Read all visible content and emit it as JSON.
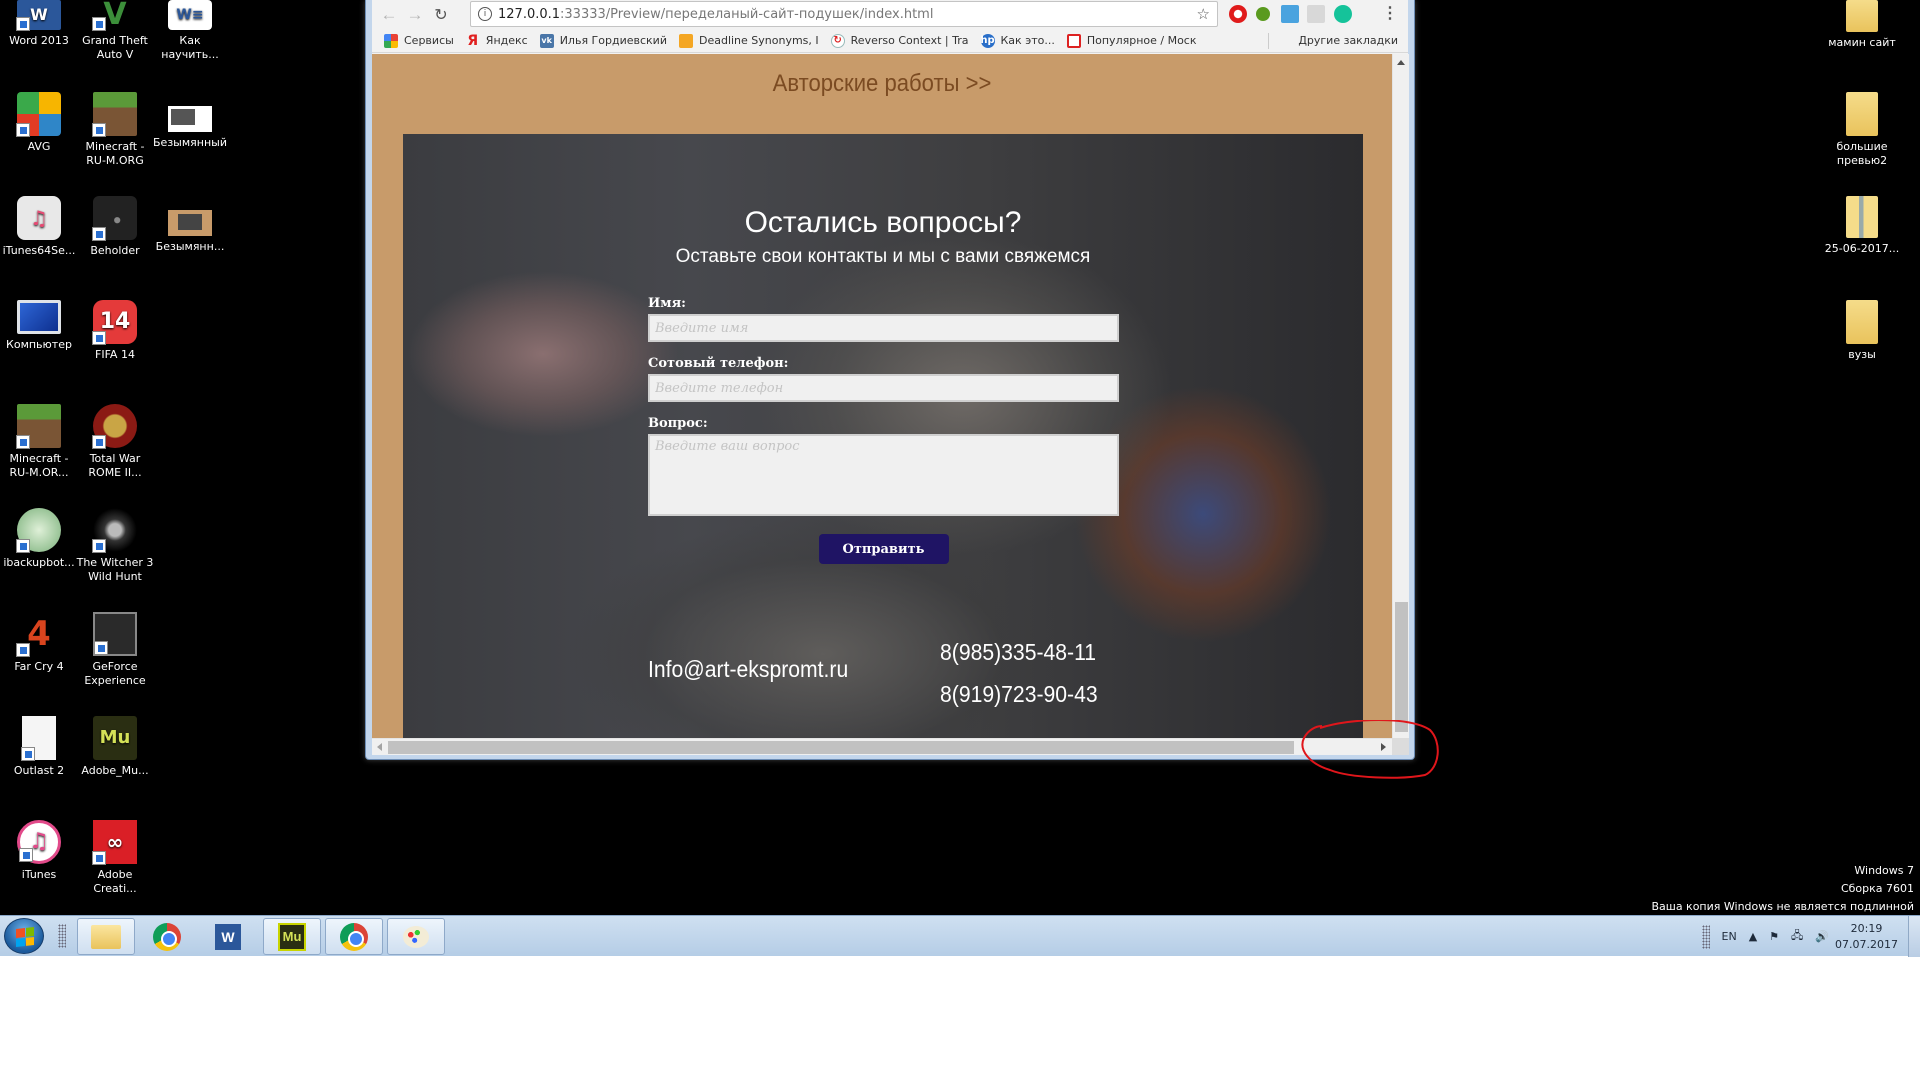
{
  "browser": {
    "url_host": "127.0.0.1",
    "url_port_path": ":33333/Preview/переделаный-сайт-подушек/index.html",
    "bookmarks": [
      {
        "label": "Сервисы",
        "icon": "apps-grid-icon"
      },
      {
        "label": "Яндекс",
        "icon": "yandex-icon"
      },
      {
        "label": "Илья Гордиевский",
        "icon": "vk-icon"
      },
      {
        "label": "Deadline Synonyms, I",
        "icon": "thesaurus-icon"
      },
      {
        "label": "Reverso Context | Tra",
        "icon": "reverso-icon"
      },
      {
        "label": "Как это...",
        "icon": "hp-icon"
      },
      {
        "label": "Популярное / Моск",
        "icon": "speech-bubble-icon"
      }
    ],
    "other_bookmarks": "Другие закладки",
    "extensions": [
      "opera-vpn",
      "bug-extension",
      "upload-extension",
      "dropbox",
      "grammarly"
    ]
  },
  "page": {
    "works_link": "Авторские работы >>",
    "hero_title": "Остались вопросы?",
    "hero_subtitle": "Оставьте свои контакты и мы с вами свяжемся",
    "form": {
      "name_label": "Имя:",
      "name_placeholder": "Введите имя",
      "phone_label": "Сотовый телефон:",
      "phone_placeholder": "Введите телефон",
      "question_label": "Вопрос:",
      "question_placeholder": "Введите ваш вопрос",
      "submit_label": "Отправить"
    },
    "contacts": {
      "email": "Info@art-ekspromt.ru",
      "phones": [
        "8(985)335-48-11",
        "8(919)723-90-43"
      ]
    },
    "colors": {
      "page_bg": "#c89b6a",
      "link": "#7b4b22",
      "submit_bg": "#1f1464"
    }
  },
  "desktop": {
    "left_icons": [
      {
        "label": "Word 2013",
        "icon": "word-icon"
      },
      {
        "label": "Grand Theft Auto V",
        "icon": "gta-icon"
      },
      {
        "label": "Как научить...",
        "icon": "word-doc-icon"
      },
      {
        "label": "AVG",
        "icon": "avg-icon"
      },
      {
        "label": "Minecraft - RU-M.ORG",
        "icon": "minecraft-icon"
      },
      {
        "label": "Безымянный",
        "icon": "image-thumbnail-icon"
      },
      {
        "label": "iTunes64Se...",
        "icon": "itunes-setup-icon"
      },
      {
        "label": "Beholder",
        "icon": "beholder-icon"
      },
      {
        "label": "Безымянн...",
        "icon": "image-thumbnail-icon"
      },
      {
        "label": "Компьютер",
        "icon": "computer-icon"
      },
      {
        "label": "FIFA 14",
        "icon": "fifa-icon"
      },
      {
        "label": "Minecraft - RU-M.OR...",
        "icon": "minecraft-icon"
      },
      {
        "label": "Total War ROME II...",
        "icon": "rome-icon"
      },
      {
        "label": "ibackupbot...",
        "icon": "ibackupbot-icon"
      },
      {
        "label": "The Witcher 3 Wild Hunt",
        "icon": "witcher-icon"
      },
      {
        "label": "Far Cry 4",
        "icon": "farcry-icon"
      },
      {
        "label": "GeForce Experience",
        "icon": "geforce-icon"
      },
      {
        "label": "Outlast 2",
        "icon": "file-icon"
      },
      {
        "label": "Adobe_Mu...",
        "icon": "adobe-muse-icon"
      },
      {
        "label": "iTunes",
        "icon": "itunes-icon"
      },
      {
        "label": "Adobe Creati...",
        "icon": "creative-cloud-icon"
      }
    ],
    "right_icons": [
      {
        "label": "мамин сайт",
        "icon": "folder-icon"
      },
      {
        "label": "большие превью2",
        "icon": "folder-icon"
      },
      {
        "label": "25-06-2017...",
        "icon": "zip-folder-icon"
      },
      {
        "label": "вузы",
        "icon": "folder-icon"
      }
    ],
    "watermark": [
      "Windows 7",
      "Сборка 7601",
      "Ваша копия Windows не является подлинной"
    ]
  },
  "taskbar": {
    "language": "EN",
    "time": "20:19",
    "date": "07.07.2017",
    "apps": [
      "explorer",
      "chrome",
      "word",
      "adobe-muse",
      "chrome-active",
      "paint"
    ]
  }
}
